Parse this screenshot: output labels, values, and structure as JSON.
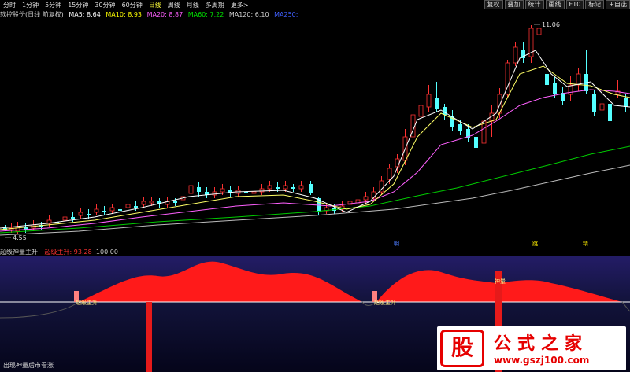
{
  "toolbar": {
    "periods": [
      "分时",
      "1分钟",
      "5分钟",
      "15分钟",
      "30分钟",
      "60分钟",
      "日线",
      "周线",
      "月线",
      "多周期",
      "更多>"
    ],
    "active_period": "日线",
    "right_buttons": [
      "复权",
      "叠加",
      "统计",
      "画线",
      "F10",
      "标记",
      "+自选"
    ]
  },
  "header": {
    "stock": "软控股份(日线 前复权)",
    "ma5": "MA5: 8.64",
    "ma10": "MA10: 8.93",
    "ma20": "MA20: 8.87",
    "ma60": "MA60: 7.22",
    "ma120": "MA120: 6.10",
    "ma250": "MA250:"
  },
  "main_labels": {
    "high": "11.06",
    "low": "4.55",
    "markers": [
      "明",
      "跳",
      "精"
    ]
  },
  "sub_header": {
    "title": "超级神量主升",
    "value_label": "超级主升: 93.28",
    "value2": ":100.00"
  },
  "sub_labels": {
    "zhusheng1": "超级主升",
    "zhusheng2": "超级主升",
    "shenliang": "神量"
  },
  "bottom_note": "出现神量后市看涨",
  "watermark": {
    "logo": "股",
    "title": "公式之家",
    "url": "www.gszj100.com"
  },
  "colors": {
    "up": "#ff3232",
    "down": "#54ffff",
    "ma5": "#ffffff",
    "ma10": "#ffff00",
    "ma20": "#ff80ff",
    "ma60": "#00e600",
    "ma120": "#cccccc",
    "sub_fill": "#ff1a1a"
  }
}
